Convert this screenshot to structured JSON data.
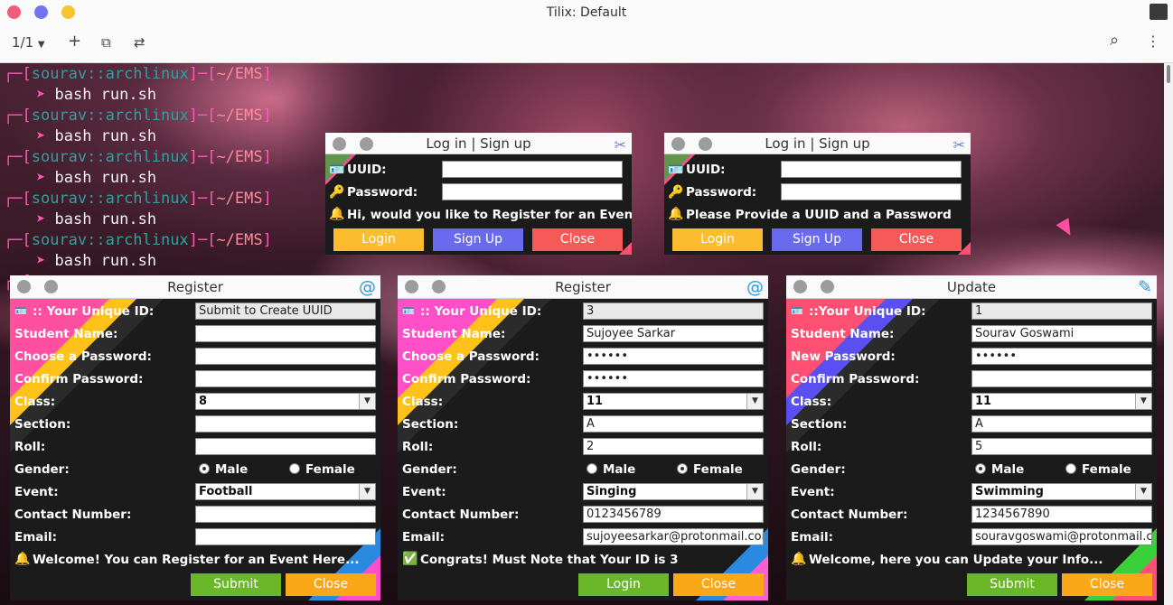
{
  "window": {
    "title": "Tilix: Default",
    "tab_counter": "1/1"
  },
  "toolbar": {
    "add": "+",
    "new_session": "⧉",
    "sync": "⇄",
    "search": "⌕",
    "menu": "⋮"
  },
  "terminal": {
    "prompt": {
      "open": "┌─[",
      "user_host": "sourav::archlinux",
      "mid": "]─[",
      "path": "~/EMS",
      "close": "]",
      "arrow": "➤"
    },
    "command": "bash run.sh"
  },
  "login1": {
    "title": "Log in | Sign up",
    "uuid_label": "UUID:",
    "password_label": "Password:",
    "message": "Hi, would you like to Register for an Event?",
    "login": "Login",
    "signup": "Sign Up",
    "close": "Close"
  },
  "login2": {
    "title": "Log in | Sign up",
    "uuid_label": "UUID:",
    "password_label": "Password:",
    "message": "Please Provide a UUID and a Password",
    "login": "Login",
    "signup": "Sign Up",
    "close": "Close"
  },
  "reg1": {
    "title": "Register",
    "uid_label": ":: Your Unique ID:",
    "uid_value": "Submit to Create UUID",
    "name_label": "Student Name:",
    "name_value": "",
    "pw_label": "Choose a Password:",
    "pw_value": "",
    "cpw_label": "Confirm Password:",
    "cpw_value": "",
    "class_label": "Class:",
    "class_value": "8",
    "section_label": "Section:",
    "section_value": "",
    "roll_label": "Roll:",
    "roll_value": "",
    "gender_label": "Gender:",
    "male": "Male",
    "female": "Female",
    "event_label": "Event:",
    "event_value": "Football",
    "contact_label": "Contact Number:",
    "contact_value": "",
    "email_label": "Email:",
    "email_value": "",
    "message": "Welcome! You can Register for an Event Here...",
    "btn1": "Submit",
    "btn2": "Close"
  },
  "reg2": {
    "title": "Register",
    "uid_label": ":: Your Unique ID:",
    "uid_value": "3",
    "name_label": "Student Name:",
    "name_value": "Sujoyee Sarkar",
    "pw_label": "Choose a Password:",
    "pw_value": "••••••",
    "cpw_label": "Confirm Password:",
    "cpw_value": "••••••",
    "class_label": "Class:",
    "class_value": "11",
    "section_label": "Section:",
    "section_value": "A",
    "roll_label": "Roll:",
    "roll_value": "2",
    "gender_label": "Gender:",
    "male": "Male",
    "female": "Female",
    "event_label": "Event:",
    "event_value": "Singing",
    "contact_label": "Contact Number:",
    "contact_value": "0123456789",
    "email_label": "Email:",
    "email_value": "sujoyeesarkar@protonmail.com",
    "message": "Congrats! Must Note that Your ID is 3",
    "btn1": "Login",
    "btn2": "Close"
  },
  "upd": {
    "title": "Update",
    "uid_label": "::Your Unique ID:",
    "uid_value": "1",
    "name_label": "Student Name:",
    "name_value": "Sourav Goswami",
    "pw_label": "New Password:",
    "pw_value": "••••••",
    "cpw_label": "Confirm Password:",
    "cpw_value": "",
    "class_label": "Class:",
    "class_value": "11",
    "section_label": "Section:",
    "section_value": "A",
    "roll_label": "Roll:",
    "roll_value": "5",
    "gender_label": "Gender:",
    "male": "Male",
    "female": "Female",
    "event_label": "Event:",
    "event_value": "Swimming",
    "contact_label": "Contact Number:",
    "contact_value": "1234567890",
    "email_label": "Email:",
    "email_value": "souravgoswami@protonmail.com",
    "message": "Welcome, here you can Update your Info...",
    "btn1": "Submit",
    "btn2": "Close"
  },
  "colors": {
    "close_dot": "#f25b79",
    "min_dot": "#7474f0",
    "max_dot": "#f5c52f",
    "login_btn": "#fbbc2f",
    "signup_btn": "#6a6af0",
    "close_btn": "#f55a58",
    "submit_btn": "#6ab82a",
    "close_btn2": "#fba818"
  }
}
